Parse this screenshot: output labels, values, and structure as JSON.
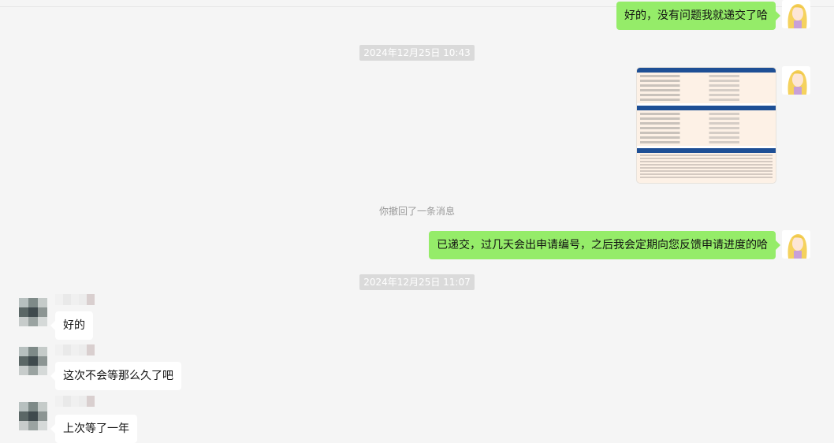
{
  "colors": {
    "background": "#f5f5f5",
    "outgoing_bubble": "#95ec69",
    "incoming_bubble": "#ffffff",
    "timestamp_bg": "#dadada",
    "doc_header": "#1e4f95"
  },
  "messages": {
    "m1": {
      "text": "好的，没有问题我就递交了哈"
    },
    "t1": {
      "text": "2024年12月25日 10:43"
    },
    "img": {
      "icon": "document-screenshot-image"
    },
    "recall": {
      "text": "你撤回了一条消息"
    },
    "m2": {
      "text": "已递交，过几天会出申请编号，之后我会定期向您反馈申请进度的哈"
    },
    "t2": {
      "text": "2024年12月25日 11:07"
    },
    "m3": {
      "text": "好的"
    },
    "m4": {
      "text": "这次不会等那么久了吧"
    },
    "m5": {
      "text": "上次等了一年"
    }
  }
}
